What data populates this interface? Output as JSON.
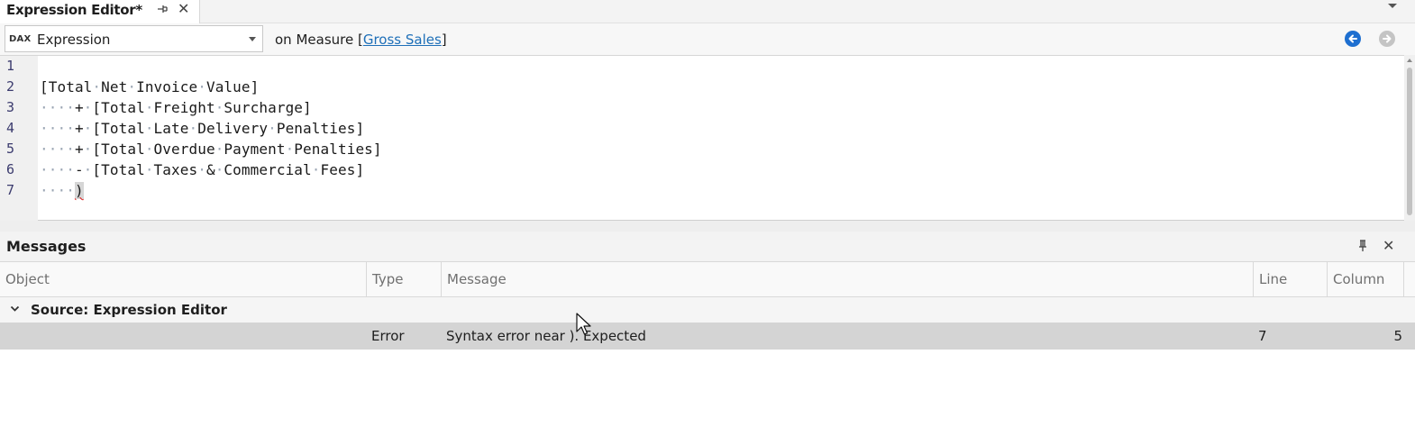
{
  "tab": {
    "title": "Expression Editor*",
    "close_glyph": "✕"
  },
  "toolbar": {
    "dax_badge": "DAX",
    "combo_value": "Expression",
    "measure_prefix": "on Measure [",
    "measure_name": "Gross Sales",
    "measure_suffix": "]"
  },
  "editor": {
    "line_numbers": [
      "1",
      "2",
      "3",
      "4",
      "5",
      "6",
      "7"
    ],
    "lines": [
      "",
      "[Total·Net·Invoice·Value]",
      "····+·[Total·Freight·Surcharge]",
      "····+·[Total·Late·Delivery·Penalties]",
      "····+·[Total·Overdue·Payment·Penalties]",
      "····-·[Total·Taxes·&·Commercial·Fees]",
      "····)"
    ]
  },
  "messages": {
    "title": "Messages",
    "close_glyph": "✕",
    "columns": [
      "Object",
      "Type",
      "Message",
      "Line",
      "Column"
    ],
    "group_label": "Source: Expression Editor",
    "rows": [
      {
        "object": "",
        "type": "Error",
        "message": "Syntax error near ). Expected",
        "line": "7",
        "column": "5"
      }
    ]
  },
  "icons": {
    "tab_pin": "pin-icon",
    "tab_close": "close-icon",
    "back": "arrow-left-circle-icon",
    "forward": "arrow-right-circle-icon",
    "panel_pin": "pin-icon",
    "panel_close": "close-icon",
    "group_toggle": "chevron-down-icon"
  },
  "colors": {
    "accent": "#1e6fd0",
    "link": "#1e6fb8",
    "selected_row": "#d4d4d4",
    "error_underline": "#dd1111"
  }
}
